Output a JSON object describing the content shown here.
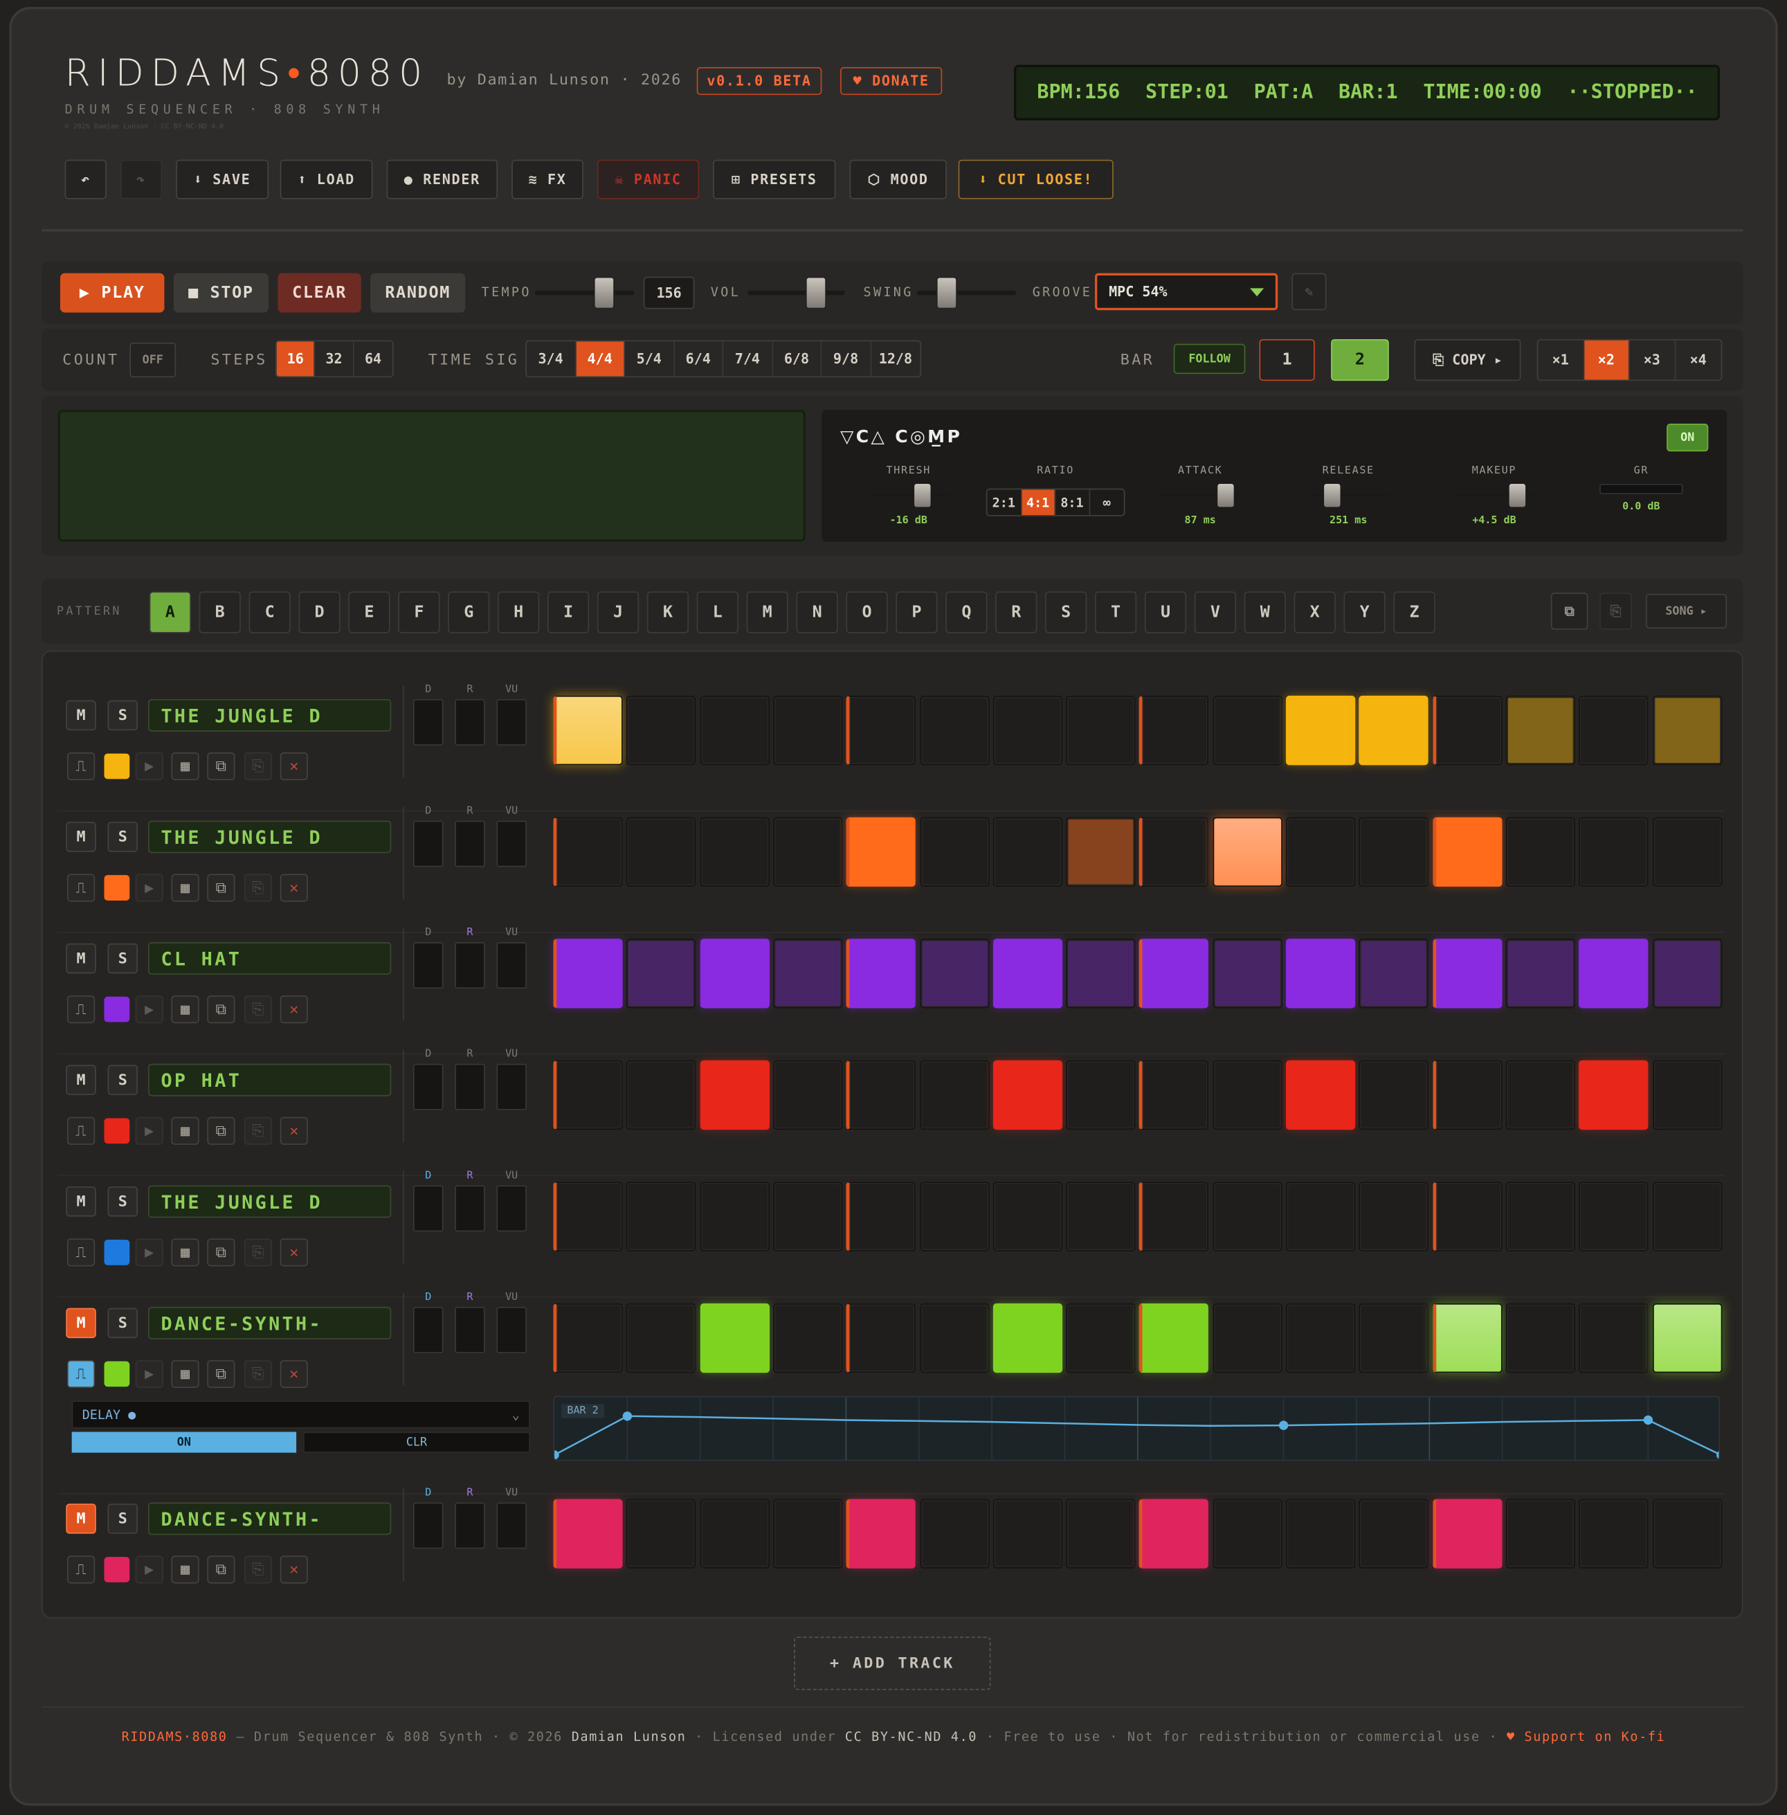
{
  "header": {
    "logo_main": "RIDDAMS",
    "logo_dot": "•",
    "logo_num": "8080",
    "by": "by Damian Lunson · 2026",
    "version_badge": "v0.1.0 BETA",
    "donate": "♥ DONATE",
    "subtitle": "DRUM SEQUENCER · 808 SYNTH",
    "fineprint": "© 2026 Damian Lunson · CC BY-NC-ND 4.0"
  },
  "lcd": {
    "bpm": "BPM:156",
    "step": "STEP:01",
    "pat": "PAT:A",
    "bar": "BAR:1",
    "time": "TIME:00:00",
    "state": "··STOPPED··"
  },
  "toolbar": {
    "undo": "↶",
    "redo": "↷",
    "save": "⬇ SAVE",
    "load": "⬆ LOAD",
    "render": "● RENDER",
    "fx": "≋ FX",
    "panic": "☠ PANIC",
    "presets": "⊞ PRESETS",
    "mood": "⬡ MOOD",
    "cut_loose": "⬇ CUT LOOSE!"
  },
  "transport": {
    "play": "▶ PLAY",
    "stop": "■ STOP",
    "clear": "CLEAR",
    "random": "RANDOM",
    "tempo_label": "TEMPO",
    "tempo_value": "156",
    "vol_label": "VOL",
    "swing_label": "SWING",
    "groove_label": "GROOVE",
    "groove_value": "MPC 54%",
    "edit_icon": "✎",
    "tempo_level": 0.7,
    "vol_level": 0.7,
    "swing_level": 0.3
  },
  "config": {
    "count_label": "COUNT",
    "count_value": "OFF",
    "steps_label": "STEPS",
    "steps": [
      "16",
      "32",
      "64"
    ],
    "steps_selected": "16",
    "timesig_label": "TIME SIG",
    "timesigs": [
      "3/4",
      "4/4",
      "5/4",
      "6/4",
      "7/4",
      "6/8",
      "9/8",
      "12/8"
    ],
    "timesig_selected": "4/4",
    "bar_label": "BAR",
    "follow": "FOLLOW",
    "bar1": "1",
    "bar2": "2",
    "copy": "⎘ COPY ▸",
    "mult": [
      "×1",
      "×2",
      "×3",
      "×4"
    ],
    "mult_selected": "×2"
  },
  "comp": {
    "title": "▽C△ C◎M̲P",
    "on": "ON",
    "thresh_label": "THRESH",
    "thresh_value": "-16 dB",
    "ratio_label": "RATIO",
    "ratios": [
      "2:1",
      "4:1",
      "8:1",
      "∞"
    ],
    "ratio_selected": "4:1",
    "attack_label": "ATTACK",
    "attack_value": "87 ms",
    "release_label": "RELEASE",
    "release_value": "251 ms",
    "makeup_label": "MAKEUP",
    "makeup_value": "+4.5 dB",
    "gr_label": "GR",
    "gr_value": "0.0 dB"
  },
  "pattern": {
    "label": "PATTERN",
    "letters": [
      "A",
      "B",
      "C",
      "D",
      "E",
      "F",
      "G",
      "H",
      "I",
      "J",
      "K",
      "L",
      "M",
      "N",
      "O",
      "P",
      "Q",
      "R",
      "S",
      "T",
      "U",
      "V",
      "W",
      "X",
      "Y",
      "Z"
    ],
    "selected": "A",
    "song": "SONG ▸"
  },
  "meters": {
    "d": "D",
    "r": "R",
    "vu": "VU"
  },
  "tracks": [
    {
      "name": "THE JUNGLE D",
      "color": "#f5b50e",
      "muted": false,
      "steps": [
        3,
        0,
        0,
        0,
        0,
        0,
        0,
        0,
        0,
        0,
        1,
        1,
        0,
        2,
        0,
        2
      ]
    },
    {
      "name": "THE JUNGLE D",
      "color": "#ff6b1a",
      "muted": false,
      "steps": [
        0,
        0,
        0,
        0,
        1,
        0,
        0,
        2,
        0,
        3,
        0,
        0,
        1,
        0,
        0,
        0
      ]
    },
    {
      "name": "CL HAT",
      "color": "#8a2be2",
      "muted": false,
      "steps": [
        1,
        2,
        1,
        2,
        1,
        2,
        1,
        2,
        1,
        2,
        1,
        2,
        1,
        2,
        1,
        2
      ]
    },
    {
      "name": "OP HAT",
      "color": "#e8261a",
      "muted": false,
      "steps": [
        0,
        0,
        1,
        0,
        0,
        0,
        1,
        0,
        0,
        0,
        1,
        0,
        0,
        0,
        1,
        0
      ]
    },
    {
      "name": "THE JUNGLE D",
      "color": "#1f7ae0",
      "muted": false,
      "steps": [
        0,
        0,
        0,
        0,
        0,
        0,
        0,
        0,
        0,
        0,
        0,
        0,
        0,
        0,
        0,
        0
      ]
    },
    {
      "name": "DANCE-SYNTH-",
      "color": "#7ed321",
      "muted": true,
      "steps": [
        0,
        0,
        1,
        0,
        0,
        0,
        1,
        0,
        1,
        0,
        0,
        0,
        3,
        0,
        0,
        3
      ]
    },
    {
      "name": "DANCE-SYNTH-",
      "color": "#e0245e",
      "muted": true,
      "steps": [
        1,
        0,
        0,
        0,
        1,
        0,
        0,
        0,
        1,
        0,
        0,
        0,
        1,
        0,
        0,
        0
      ]
    }
  ],
  "automation": {
    "param": "DELAY ●",
    "on": "ON",
    "clr": "CLR",
    "bar_tag": "BAR 2",
    "points": [
      0.0,
      0.8,
      0.78,
      0.75,
      0.72,
      0.7,
      0.68,
      0.65,
      0.62,
      0.6,
      0.61,
      0.63,
      0.65,
      0.68,
      0.7,
      0.72,
      0.0
    ]
  },
  "add_track": "+ ADD TRACK",
  "footer": {
    "brand": "RIDDAMS·8080",
    "p1": " — Drum Sequencer & 808 Synth  ·  © 2026 ",
    "author": "Damian Lunson",
    "p2": "  ·  Licensed under ",
    "license": "CC BY-NC-ND 4.0",
    "p3": "  ·  Free to use · Not for redistribution or commercial use  ·  ",
    "kofi": "♥ Support on Ko-fi"
  }
}
